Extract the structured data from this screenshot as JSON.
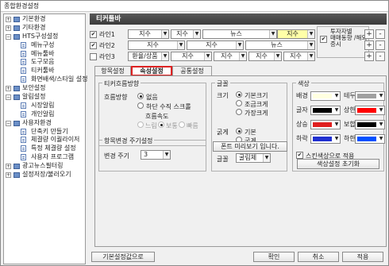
{
  "window": {
    "title": "종합환경설정"
  },
  "tree": [
    {
      "label": "기본환경",
      "type": "folder",
      "exp": "+",
      "indent": 0
    },
    {
      "label": "기타환경",
      "type": "folder",
      "exp": "+",
      "indent": 0
    },
    {
      "label": "HTS구성설정",
      "type": "folder",
      "exp": "-",
      "indent": 0
    },
    {
      "label": "메뉴구성",
      "type": "page",
      "indent": 1
    },
    {
      "label": "메뉴툴바",
      "type": "page",
      "indent": 1
    },
    {
      "label": "도구모음",
      "type": "page",
      "indent": 1
    },
    {
      "label": "티커툴바",
      "type": "page",
      "indent": 1
    },
    {
      "label": "화면배색/스타일 설정",
      "type": "page",
      "indent": 1
    },
    {
      "label": "보안설정",
      "type": "folder",
      "exp": "+",
      "indent": 0
    },
    {
      "label": "알림설정",
      "type": "folder",
      "exp": "-",
      "indent": 0
    },
    {
      "label": "시장알림",
      "type": "page",
      "indent": 1
    },
    {
      "label": "개인알림",
      "type": "page",
      "indent": 1
    },
    {
      "label": "사용자환경",
      "type": "folder",
      "exp": "-",
      "indent": 0
    },
    {
      "label": "단축키 만들기",
      "type": "page",
      "indent": 1
    },
    {
      "label": "체결량 이퀄라이저",
      "type": "page",
      "indent": 1
    },
    {
      "label": "특정 체결량 설정",
      "type": "page",
      "indent": 1
    },
    {
      "label": "사용자 프로그램",
      "type": "page",
      "indent": 1
    },
    {
      "label": "광고뉴스필터링",
      "type": "folder",
      "exp": "+",
      "indent": 0
    },
    {
      "label": "설정저장/불러오기",
      "type": "folder",
      "exp": "+",
      "indent": 0
    }
  ],
  "header": {
    "title": "티커툴바"
  },
  "lines": [
    {
      "label": "라인1",
      "checked": true,
      "dd": [
        "지수",
        "지수",
        "뉴스",
        "지수"
      ]
    },
    {
      "label": "라인2",
      "checked": true,
      "dd": [
        "지수",
        "지수",
        "뉴스"
      ]
    },
    {
      "label": "라인3",
      "checked": false,
      "dd": [
        "환율/상품",
        "지수",
        "지수",
        "지수",
        "지수"
      ]
    }
  ],
  "investor_box": {
    "label": "투자자별",
    "check_label": "매매동향 /해외증시",
    "checked": true
  },
  "side_buttons": [
    "+",
    "-",
    "+",
    "-",
    "+",
    "-"
  ],
  "tabs": {
    "items": [
      "항목설정",
      "속성설정",
      "공통설정"
    ],
    "active": "속성설정"
  },
  "ticker_flow": {
    "title": "티커흐름방향",
    "direction_label": "흐름방향",
    "opt_none": "없음",
    "opt_scroll": "하단 수직 스크롤",
    "speed_label": "흐름속도",
    "speed_slow": "느림",
    "speed_normal": "보통",
    "speed_fast": "빠름"
  },
  "refresh": {
    "title": "항목변경 주기설정",
    "label": "변경 주기",
    "value": "3"
  },
  "font": {
    "title": "글꼴",
    "size_label": "크기",
    "size_opts": [
      "기본크기",
      "조금크게",
      "가장크게"
    ],
    "weight_label": "굵게",
    "weight_opts": [
      "기본",
      "굵게"
    ],
    "face_label": "글꼴",
    "face_value": "굴림체",
    "preview_button": "폰트 미리보기 입니다."
  },
  "color": {
    "title": "색상",
    "rows": [
      {
        "l": "배경",
        "lc": "#ffffe0",
        "r": "테두리",
        "rc": "#a0a0a0"
      },
      {
        "l": "글자",
        "lc": "#000000",
        "r": "상한",
        "rc": "#ff0000"
      },
      {
        "l": "상승",
        "lc": "#e02020",
        "r": "보합",
        "rc": "#000000"
      },
      {
        "l": "하락",
        "lc": "#2030d0",
        "r": "하한",
        "rc": "#0050ff"
      }
    ],
    "apply_label": "스킨색상으로 적용",
    "reset_button": "색상설정 초기화"
  },
  "footer": {
    "defaults": "기본설정값으로",
    "ok": "확인",
    "cancel": "취소",
    "apply": "적용"
  }
}
